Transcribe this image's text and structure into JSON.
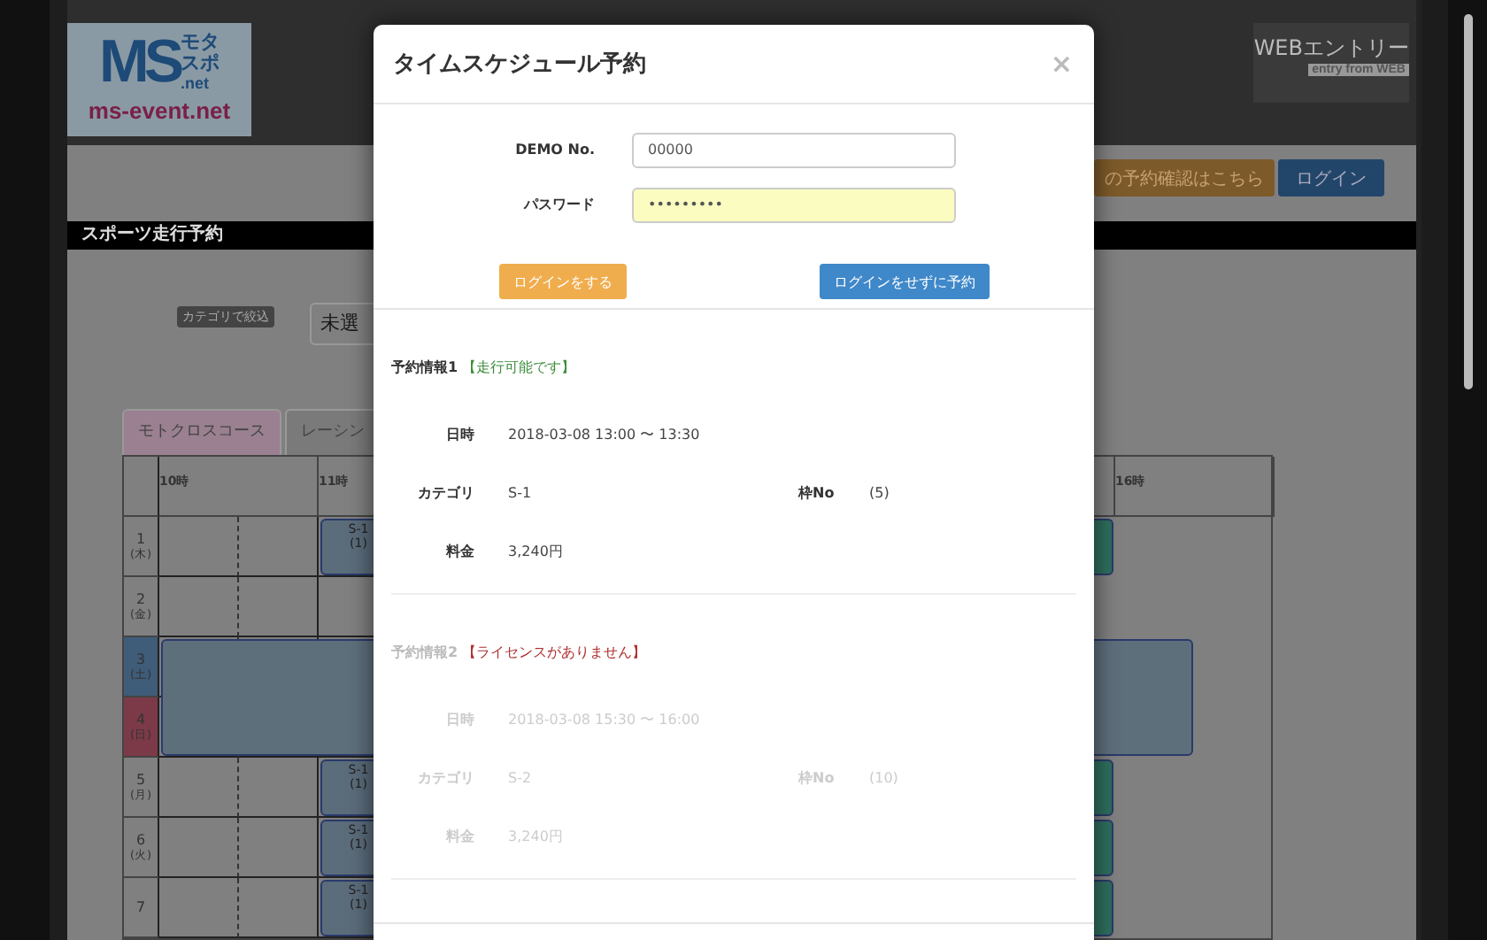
{
  "logo": {
    "initials": "MS",
    "kana_top": "モタ",
    "kana_bottom": "スポ",
    "suffix": ".net",
    "domain": "ms-event.net"
  },
  "web_entry": {
    "title": "WEBエントリー",
    "subtitle": "entry from WEB"
  },
  "top_buttons": [
    {
      "label": "の予約確認はこちら",
      "kind": "warning"
    },
    {
      "label": "ログイン",
      "kind": "primary"
    }
  ],
  "section_title": "スポーツ走行予約",
  "filter": {
    "label": "カテゴリで絞込",
    "value": "未選"
  },
  "tabs": [
    {
      "label": "モトクロスコース",
      "selected": true
    },
    {
      "label": "レーシン",
      "selected": false
    }
  ],
  "timetable": {
    "hours": [
      "10時",
      "11時",
      "16時"
    ],
    "rows": [
      {
        "day": "1",
        "weekday": "(木)",
        "kind": "weekday",
        "blocks": [
          {
            "kind": "session",
            "category": "S-1",
            "slot": "(1)",
            "color": "#5b6c7b"
          },
          {
            "kind": "open",
            "color": "#2f6f5f"
          }
        ]
      },
      {
        "day": "2",
        "weekday": "(金)",
        "kind": "weekday",
        "blocks": []
      },
      {
        "day": "3",
        "weekday": "(土)",
        "kind": "saturday",
        "blocks": [
          {
            "kind": "event",
            "color": "#5e6f7c"
          }
        ]
      },
      {
        "day": "4",
        "weekday": "(日)",
        "kind": "sunday",
        "blocks": []
      },
      {
        "day": "5",
        "weekday": "(月)",
        "kind": "weekday",
        "blocks": [
          {
            "kind": "session",
            "category": "S-1",
            "slot": "(1)",
            "color": "#5b6c7b"
          },
          {
            "kind": "open",
            "color": "#2f6f5f"
          }
        ]
      },
      {
        "day": "6",
        "weekday": "(火)",
        "kind": "weekday",
        "blocks": [
          {
            "kind": "session",
            "category": "S-1",
            "slot": "(1)",
            "color": "#5b6c7b"
          },
          {
            "kind": "open",
            "color": "#2f6f5f"
          }
        ]
      },
      {
        "day": "7",
        "kind": "weekday",
        "blocks": [
          {
            "kind": "session",
            "category": "S-1",
            "slot": "(1)",
            "color": "#5b6c7b"
          },
          {
            "kind": "open",
            "color": "#2f6f5f"
          }
        ]
      }
    ]
  },
  "modal": {
    "title": "タイムスケジュール予約",
    "close": "×",
    "fields": [
      {
        "label": "DEMO No.",
        "value": "00000",
        "autofilled": false
      },
      {
        "label": "パスワード",
        "value": "•••••••••",
        "autofilled": true
      }
    ],
    "buttons": [
      {
        "label": "ログインをする",
        "kind": "warning"
      },
      {
        "label": "ログインをせずに予約",
        "kind": "primary"
      }
    ],
    "reservations": [
      {
        "title": "予約情報1",
        "status": "【走行可能です】",
        "available": true,
        "date_label": "日時",
        "date": "2018-03-08 13:00 〜 13:30",
        "category_label": "カテゴリ",
        "category": "S-1",
        "slot_label": "枠No",
        "slot": "(5)",
        "fee_label": "料金",
        "fee": "3,240円"
      },
      {
        "title": "予約情報2",
        "status": "【ライセンスがありません】",
        "available": false,
        "date_label": "日時",
        "date": "2018-03-08 15:30 〜 16:00",
        "category_label": "カテゴリ",
        "category": "S-2",
        "slot_label": "枠No",
        "slot": "(10)",
        "fee_label": "料金",
        "fee": "3,240円"
      }
    ]
  }
}
